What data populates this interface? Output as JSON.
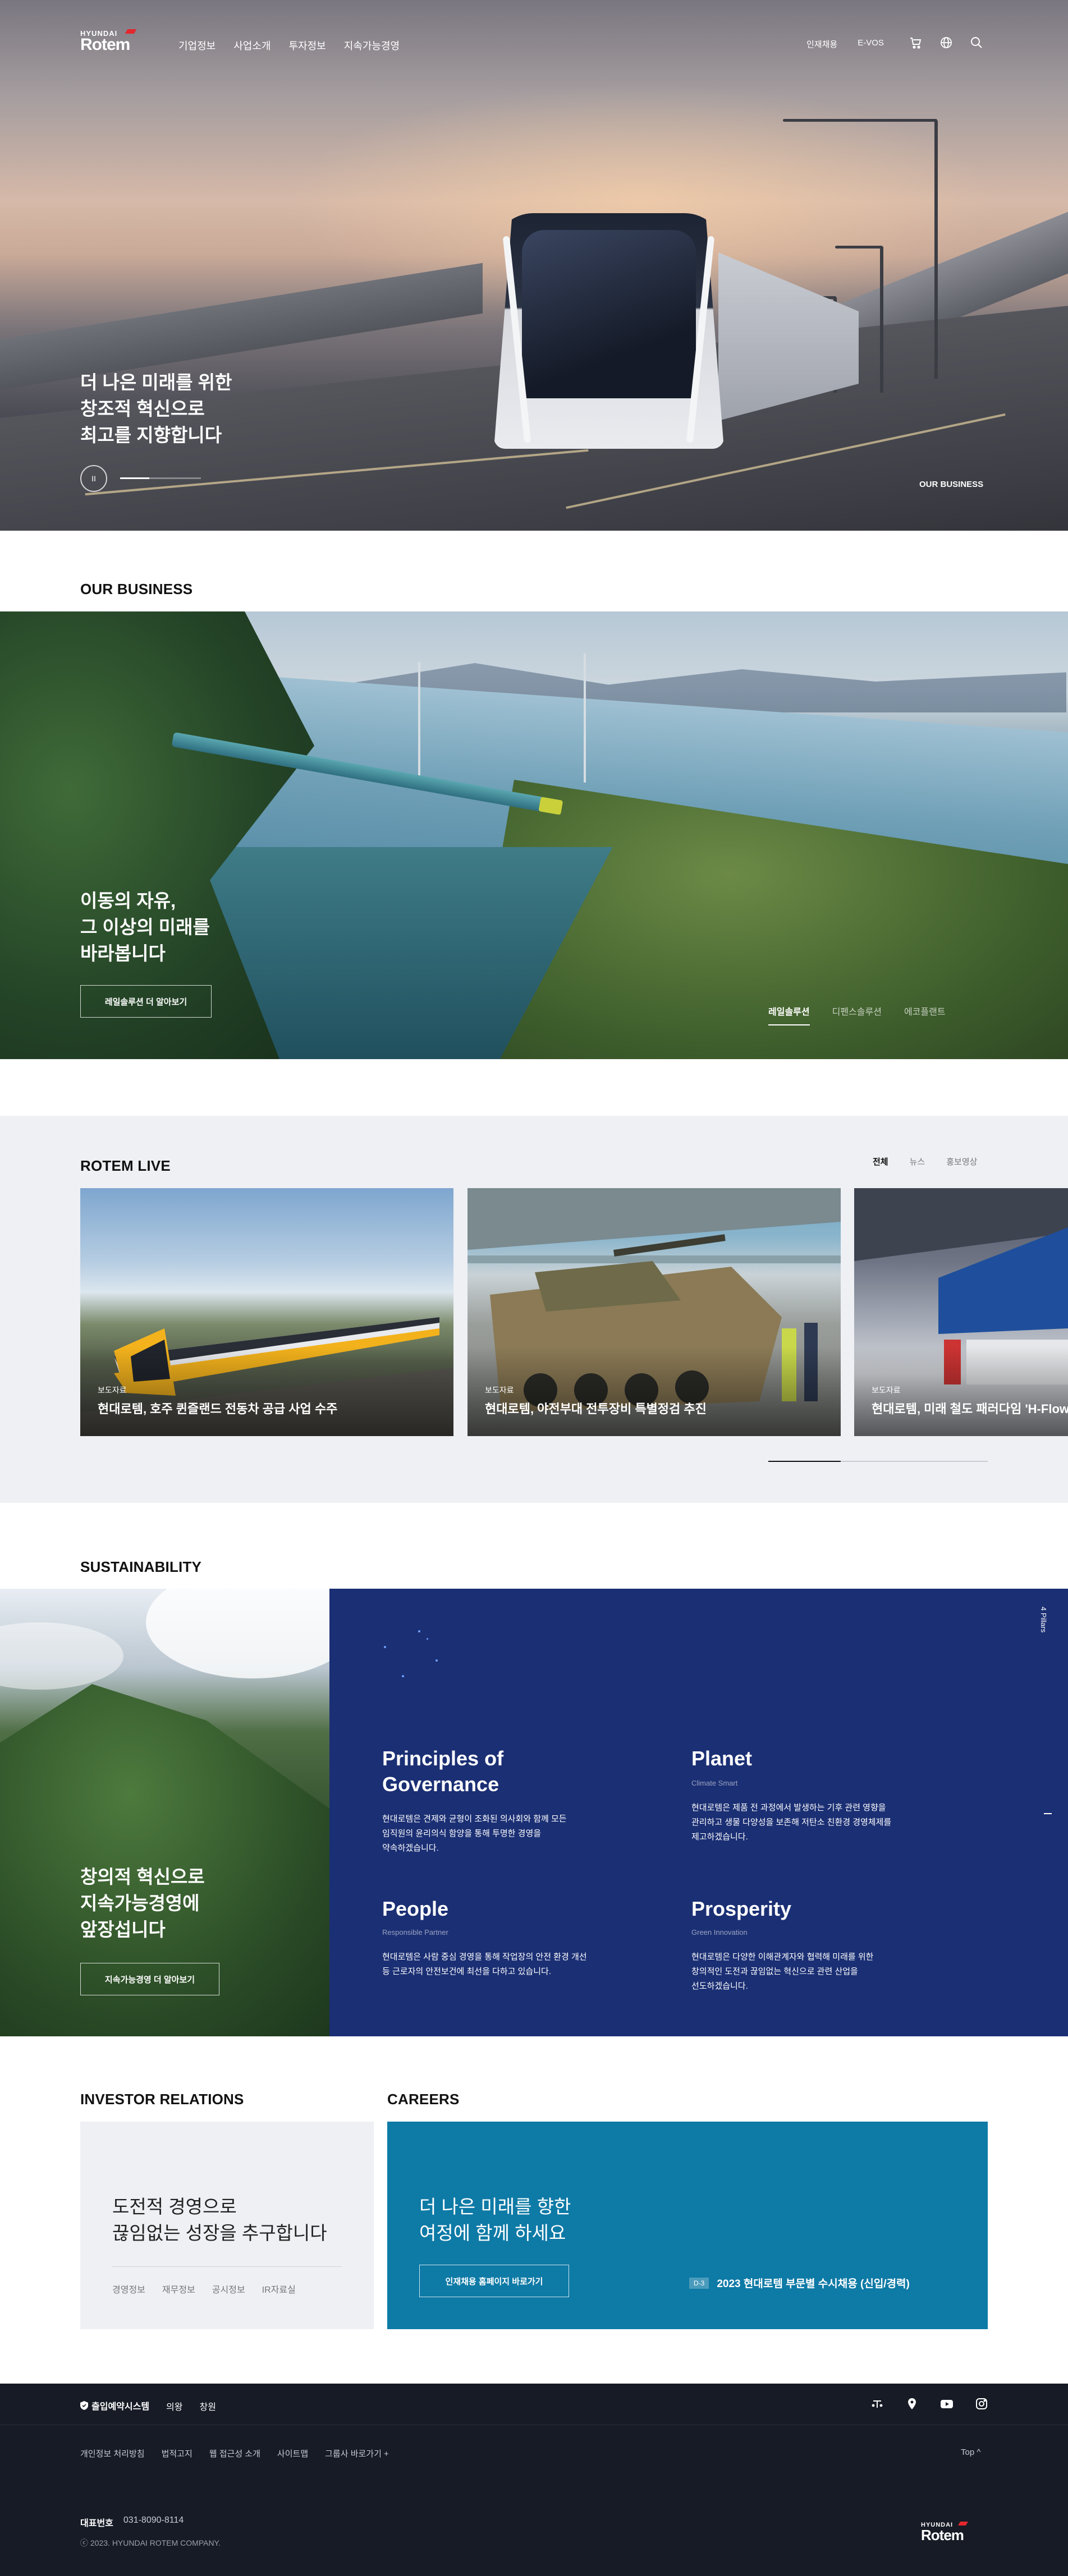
{
  "header": {
    "logo_top": "HYUNDAI",
    "logo_main": "Rotem",
    "menu": [
      "기업정보",
      "사업소개",
      "투자정보",
      "지속가능경영"
    ],
    "util": [
      "인재채용",
      "E-VOS"
    ],
    "icons": [
      "cart-icon",
      "globe-icon",
      "search-icon"
    ]
  },
  "hero": {
    "title_lines": [
      "더 나은 미래를 위한",
      "창조적 혁신으로",
      "최고를 지향합니다"
    ],
    "pause_symbol": "II",
    "slide_progress": 0.36,
    "link": "OUR BUSINESS"
  },
  "business": {
    "section_title": "OUR BUSINESS",
    "headline_lines": [
      "이동의 자유,",
      "그 이상의 미래를",
      "바라봅니다"
    ],
    "button": "레일솔루션 더 알아보기",
    "tabs": [
      "레일솔루션",
      "디펜스솔루션",
      "에코플랜트"
    ],
    "active_tab": 0
  },
  "live": {
    "section_title": "ROTEM LIVE",
    "filters": [
      "전체",
      "뉴스",
      "홍보영상"
    ],
    "active_filter": 0,
    "cards": [
      {
        "tag": "보도자료",
        "title": "현대로템, 호주 퀸즐랜드 전동차 공급 사업 수주"
      },
      {
        "tag": "보도자료",
        "title": "현대로템, 야전부대 전투장비 특별정검 추진"
      },
      {
        "tag": "보도자료",
        "title": "현대로템, 미래 철도 패러다임 'H-Flow'"
      }
    ],
    "scroll_progress": 0.33
  },
  "sustainability": {
    "section_title": "SUSTAINABILITY",
    "headline_lines": [
      "창의적 혁신으로",
      "지속가능경영에",
      "앞장섭니다"
    ],
    "button": "지속가능경영 더 알아보기",
    "pillars_tag": "4 Pillars",
    "pillars": [
      {
        "title_lines": [
          "Principles of",
          "Governance"
        ],
        "subtitle": "",
        "desc_lines": [
          "현대로템은 견제와 균형이 조화된 의사회와 함께 모든",
          "임직원의 윤리의식 함양을 통해 투명한 경영을",
          "약속하겠습니다."
        ]
      },
      {
        "title_lines": [
          "Planet"
        ],
        "subtitle": "Climate Smart",
        "desc_lines": [
          "현대로템은 제품 전 과정에서 발생하는 기후 관련 영향을",
          "관리하고 생물 다양성을 보존해 저탄소 친환경 경영체제를",
          "제고하겠습니다."
        ]
      },
      {
        "title_lines": [
          "People"
        ],
        "subtitle": "Responsible Partner",
        "desc_lines": [
          "현대로템은 사람 중심 경영을 통해 작업장의 안전 환경 개선",
          "등 근로자의 안전보건에 최선을 다하고 있습니다."
        ]
      },
      {
        "title_lines": [
          "Prosperity"
        ],
        "subtitle": "Green Innovation",
        "desc_lines": [
          "현대로템은 다양한 이해관계자와 협력해 미래를 위한",
          "창의적인 도전과 끊임없는 혁신으로 관련 산업을",
          "선도하겠습니다."
        ]
      }
    ]
  },
  "ir": {
    "section_title": "INVESTOR RELATIONS",
    "headline_lines": [
      "도전적 경영으로",
      "끊임없는 성장을 추구합니다"
    ],
    "links": [
      "경영정보",
      "재무정보",
      "공시정보",
      "IR자료실"
    ]
  },
  "careers": {
    "section_title": "CAREERS",
    "headline_lines": [
      "더 나은 미래를 향한",
      "여정에 함께 하세요"
    ],
    "button": "인재채용 홈페이지 바로가기",
    "notice_badge": "D-3",
    "notice_text": "2023 현대로템 부문별 수시채용 (신입/경력)"
  },
  "footer": {
    "row1": [
      "출입예약시스템",
      "의왕",
      "창원"
    ],
    "social_icons": [
      "link-icon",
      "blog-icon",
      "youtube-icon",
      "instagram-icon"
    ],
    "links": [
      "개인정보 처리방침",
      "법적고지",
      "웹 접근성 소개",
      "사이트맵",
      "그룹사 바로가기 +"
    ],
    "top": "Top ^",
    "phone_label": "대표번호",
    "phone": "031-8090-8114",
    "copyright": "ⓒ 2023. HYUNDAI ROTEM COMPANY.",
    "logo_top": "HYUNDAI",
    "logo_main": "Rotem"
  }
}
